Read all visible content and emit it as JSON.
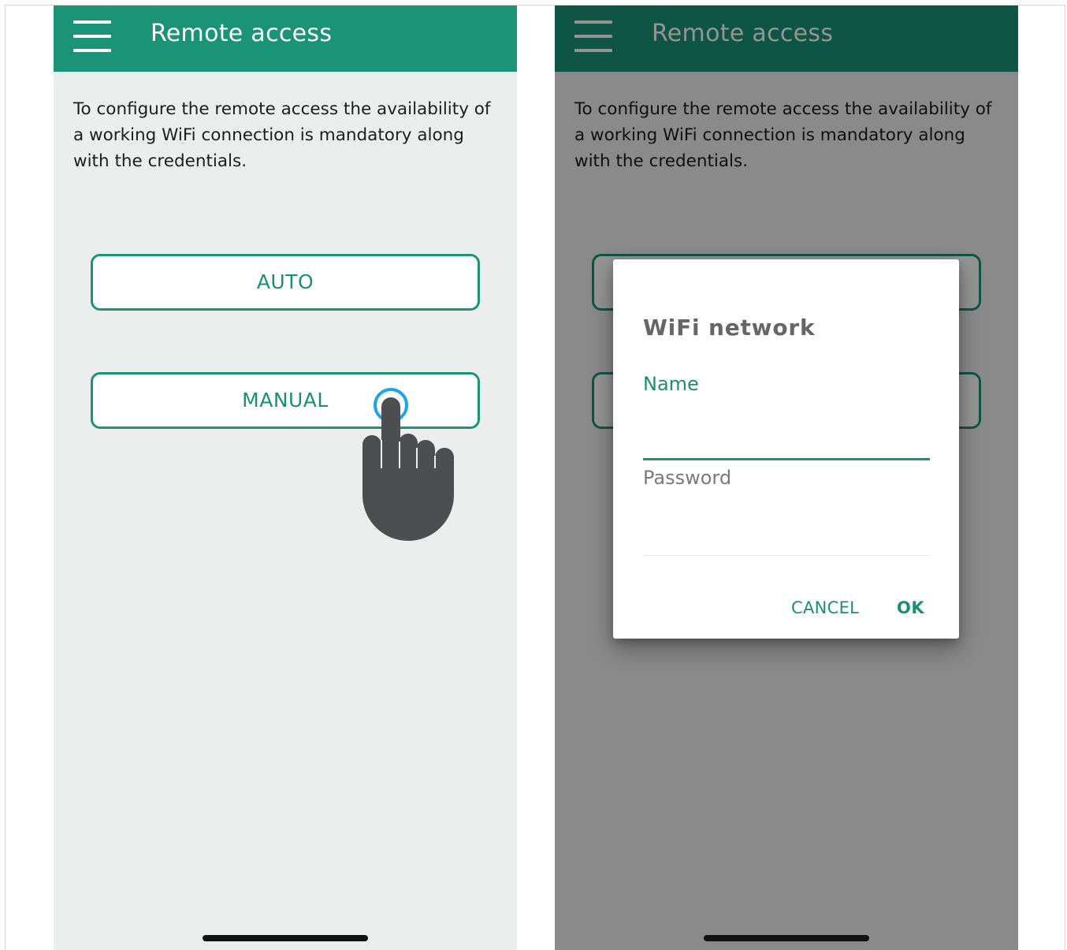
{
  "colors": {
    "accent": "#1b9377",
    "background": "#eceeed",
    "tap_ring": "#1aa6e6",
    "hand": "#4d4e50"
  },
  "left_screen": {
    "header": {
      "menu_icon": "hamburger-menu-icon",
      "title": "Remote access"
    },
    "intro": "To configure the remote access the availability of a working WiFi connection is mandatory along with the credentials.",
    "buttons": {
      "auto": "AUTO",
      "manual": "MANUAL"
    },
    "gesture_icon": "tap-hand-icon"
  },
  "right_screen": {
    "header": {
      "menu_icon": "hamburger-menu-icon",
      "title": "Remote access"
    },
    "intro": "To configure the remote access the availability of a working WiFi connection is mandatory along with the credentials.",
    "dialog": {
      "title": "WiFi network",
      "name_label": "Name",
      "name_value": "",
      "password_label": "Password",
      "password_value": "",
      "cancel": "CANCEL",
      "ok": "OK"
    }
  }
}
